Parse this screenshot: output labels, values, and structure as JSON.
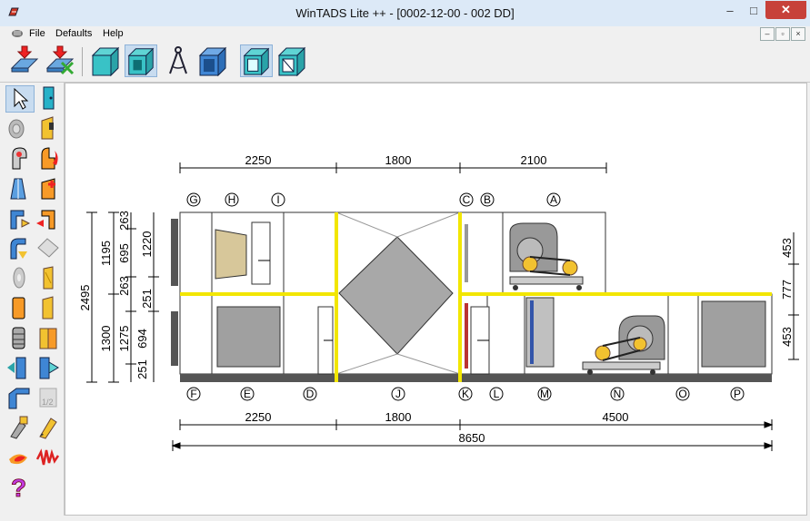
{
  "window": {
    "title": "WinTADS Lite ++ - [0002-12-00 - 002 DD]",
    "minimize": "–",
    "maximize": "□",
    "close": "✕"
  },
  "menu": {
    "file": "File",
    "defaults": "Defaults",
    "help": "Help"
  },
  "toolbar": {
    "icons": [
      "import-unit-icon",
      "delete-unit-icon",
      "duct-view-icon",
      "duct-section-icon",
      "compass-icon",
      "casing-cube-icon",
      "wireframe-cube-icon",
      "wireframe-cube-2-icon"
    ]
  },
  "left_tools": {
    "icons": [
      "pointer-tool-icon",
      "door-panel-icon",
      "filter-roll-icon",
      "door-yellow-icon",
      "fan-gray-icon",
      "heater-flame-icon",
      "damper-icon",
      "coil-plus-icon",
      "elbow-blue-icon",
      "elbow-red-icon",
      "bend-icon",
      "silencer-icon",
      "disc-icon",
      "panel-yellow-icon",
      "panel-orange-icon",
      "panel-plain-icon",
      "stacked-filter-icon",
      "book-filter-icon",
      "split-blue-icon",
      "arrow-right-icon",
      "frame-blue-icon",
      "text-tool-icon",
      "paint-icon",
      "pencil-icon",
      "fire-icon",
      "wave-icon",
      "help-icon"
    ]
  },
  "drawing": {
    "top_dims": [
      "2250",
      "1800",
      "2100"
    ],
    "bottom_dims": [
      "2250",
      "1800",
      "4500"
    ],
    "total_dim": "8650",
    "left_outer": "2495",
    "left_upper": [
      "1195",
      "1300"
    ],
    "left_inner": [
      "695",
      "263",
      "1275",
      "694",
      "251"
    ],
    "left_inner_small": [
      "263",
      "251"
    ],
    "left_right": [
      "1220",
      "251"
    ],
    "right_dims": [
      "453",
      "777",
      "453"
    ],
    "top_labels": [
      "G",
      "H",
      "I",
      "C",
      "B",
      "A"
    ],
    "bottom_labels": [
      "F",
      "E",
      "D",
      "J",
      "K",
      "L",
      "M",
      "N",
      "O",
      "P"
    ]
  },
  "colors": {
    "accent": "#f2e600",
    "titlebar": "#dce9f7",
    "close": "#c7413a"
  }
}
